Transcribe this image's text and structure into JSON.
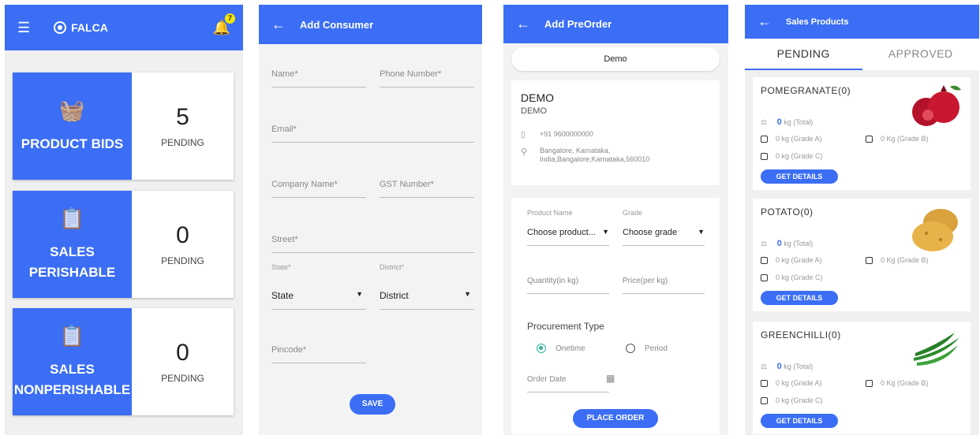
{
  "screen1": {
    "app_name": "FALCA",
    "notification_count": "7",
    "cards": [
      {
        "label_line1": "PRODUCT BIDS",
        "label_line2": "",
        "count": "5",
        "status": "PENDING"
      },
      {
        "label_line1": "SALES",
        "label_line2": "PERISHABLE",
        "count": "0",
        "status": "PENDING"
      },
      {
        "label_line1": "SALES",
        "label_line2": "NONPERISHABLE",
        "count": "0",
        "status": "PENDING"
      }
    ]
  },
  "screen2": {
    "title": "Add Consumer",
    "fields": {
      "name": "Name*",
      "phone": "Phone Number*",
      "email": "Email*",
      "company": "Company Name*",
      "gst": "GST Number*",
      "street": "Street*",
      "state_label": "State*",
      "state_value": "State",
      "district_label": "District*",
      "district_value": "District",
      "pincode": "Pincode*"
    },
    "save_label": "SAVE"
  },
  "screen3": {
    "title": "Add PreOrder",
    "selected_customer": "Demo",
    "customer_name": "DEMO",
    "customer_sub": "DEMO",
    "phone": "+91 9600000000",
    "address_line1": "Bangalore, Karnataka,",
    "address_line2": "India,Bangalore,Karnataka,560010",
    "product_name_label": "Product Name",
    "product_placeholder": "Choose product...",
    "grade_label": "Grade",
    "grade_placeholder": "Choose grade",
    "quantity_placeholder": "Quantity(in kg)",
    "price_placeholder": "Price(per kg)",
    "procurement_label": "Procurement Type",
    "option_onetime": "Onetime",
    "option_period": "Period",
    "order_date_placeholder": "Order Date",
    "place_order_label": "PLACE ORDER"
  },
  "screen4": {
    "title": "Sales Products",
    "tab_pending": "PENDING",
    "tab_approved": "APPROVED",
    "products": [
      {
        "name": "POMEGRANATE(0)",
        "total_value": "0",
        "total_unit": "kg (Total)",
        "grade_a": "0 kg (Grade A)",
        "grade_b": "0 Kg (Grade B)",
        "grade_c": "0 kg (Grade C)",
        "button": "GET DETAILS"
      },
      {
        "name": "POTATO(0)",
        "total_value": "0",
        "total_unit": "kg (Total)",
        "grade_a": "0 kg (Grade A)",
        "grade_b": "0 Kg (Grade B)",
        "grade_c": "0 kg (Grade C)",
        "button": "GET DETAILS"
      },
      {
        "name": "GREENCHILLI(0)",
        "total_value": "0",
        "total_unit": "kg (Total)",
        "grade_a": "0 kg (Grade A)",
        "grade_b": "0 Kg (Grade B)",
        "grade_c": "0 kg (Grade C)",
        "button": "GET DETAILS"
      }
    ]
  },
  "colors": {
    "primary": "#3b6ef5",
    "badge": "#f5e600",
    "radio_on": "#2bb39a"
  }
}
